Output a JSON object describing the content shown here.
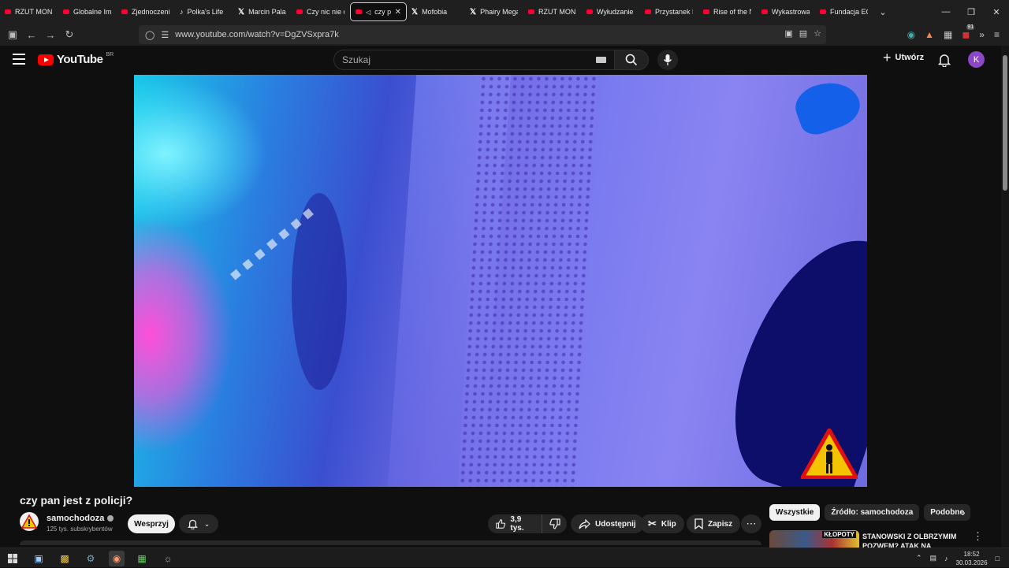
{
  "browser": {
    "tabs": [
      {
        "label": "RZUT MONE",
        "favicon": "youtube-icon"
      },
      {
        "label": "Globalne Imp",
        "favicon": "youtube-icon"
      },
      {
        "label": "Zjednoczeni",
        "favicon": "youtube-icon"
      },
      {
        "label": "Polka's Life i",
        "favicon": "tiktok-icon"
      },
      {
        "label": "Marcin Palad",
        "favicon": "x-icon"
      },
      {
        "label": "Czy nic nie d",
        "favicon": "youtube-icon"
      },
      {
        "label": "czy pa",
        "favicon": "youtube-icon",
        "active": true
      },
      {
        "label": "Mofobia",
        "favicon": "x-icon"
      },
      {
        "label": "Phairy Megar",
        "favicon": "x-icon"
      },
      {
        "label": "RZUT MONE",
        "favicon": "youtube-icon"
      },
      {
        "label": "Wyłudzanie p",
        "favicon": "youtube-icon"
      },
      {
        "label": "Przystanek Li",
        "favicon": "youtube-icon"
      },
      {
        "label": "Rise of the N",
        "favicon": "youtube-icon"
      },
      {
        "label": "Wykastrowa",
        "favicon": "youtube-icon"
      },
      {
        "label": "Fundacja ECF",
        "favicon": "youtube-icon"
      }
    ],
    "url": "www.youtube.com/watch?v=DgZVSxpra7k",
    "extension_badge": "91"
  },
  "youtube": {
    "logo_text": "YouTube",
    "country_code": "BR",
    "search_placeholder": "Szukaj",
    "create_label": "Utwórz",
    "avatar_letter": "K"
  },
  "video": {
    "title": "czy pan jest z policji?",
    "channel_name": "samochodoza",
    "subscribers": "125 tys. subskrybentów",
    "support_label": "Wesprzyj",
    "likes": "3,9 tys.",
    "share_label": "Udostępnij",
    "clip_label": "Klip",
    "save_label": "Zapisz"
  },
  "sidebar": {
    "chips": [
      "Wszystkie",
      "Źródło: samochodoza",
      "Podobne"
    ],
    "recommendation": {
      "title": "STANOWSKI Z OLBRZYMIM POZWEM? ATAK NA",
      "thumb_text": "KŁOPOTY"
    }
  },
  "taskbar": {
    "time": "18:52",
    "date": "30.03.2026"
  },
  "colors": {
    "yt_red": "#ff0000",
    "avatar": "#8b47c6",
    "background": "#0f0f0f"
  }
}
